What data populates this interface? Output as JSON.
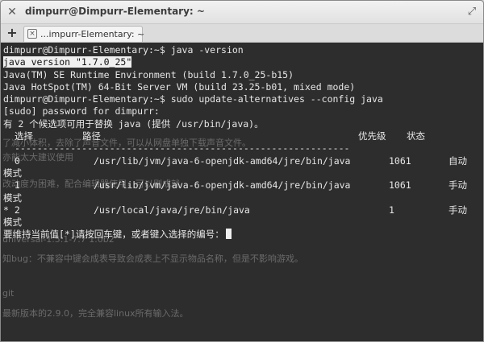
{
  "window": {
    "title": "dimpurr@Dimpurr-Elementary: ~",
    "close_glyph": "✕",
    "maximize_glyph": "⤢"
  },
  "tabs": {
    "new_tab_glyph": "+",
    "items": [
      {
        "label": "...impurr-Elementary: ~",
        "close_glyph": "×"
      }
    ]
  },
  "terminal": {
    "lines": [
      "dimpurr@Dimpurr-Elementary:~$ java -version",
      "java version \"1.7.0_25\"",
      "Java(TM) SE Runtime Environment (build 1.7.0_25-b15)",
      "Java HotSpot(TM) 64-Bit Server VM (build 23.25-b01, mixed mode)",
      "dimpurr@Dimpurr-Elementary:~$ sudo update-alternatives --config java",
      "[sudo] password for dimpurr:",
      "有 2 个候选项可用于替换 java (提供 /usr/bin/java)。"
    ],
    "table_header": {
      "select": "选择",
      "path": "路径",
      "priority": "优先级",
      "status": "状态"
    },
    "separator": "------------------------------------------------------------",
    "rows": [
      {
        "select": "  0",
        "path": "/usr/lib/jvm/java-6-openjdk-amd64/jre/bin/java",
        "priority": "1061",
        "status": "自动",
        "status_cont": "模式"
      },
      {
        "select": "  1",
        "path": "/usr/lib/jvm/java-6-openjdk-amd64/jre/bin/java",
        "priority": "1061",
        "status": "手动",
        "status_cont": "模式"
      },
      {
        "select": "* 2",
        "path": "/usr/local/java/jre/bin/java",
        "priority": "1",
        "status": "手动",
        "status_cont": "模式"
      }
    ],
    "prompt": "要维持当前值[*]请按回车键，或者键入选择的编号："
  },
  "background_text": {
    "lines": [
      {
        "text": "了减小体积，去除了声音文件，可以从网盘单独下载声音文件。"
      },
      {
        "text": "亦能太大建议使用"
      },
      {
        "text": "改动度为困难，配合编辑器使用，可以刷成就"
      },
      {
        "text": "universal-1.5.1-7.7 1.0b2"
      },
      {
        "text": "知bug：不兼容中键会成表导致会成表上不显示物品名称，但是不影响游戏。"
      },
      {
        "text": "git"
      },
      {
        "text": "最新版本的2.9.0，完全兼容linux所有输入法。"
      }
    ]
  },
  "colors": {
    "terminal_bg": "#2d2d2d",
    "terminal_fg": "#e6e6e6",
    "highlight_bg": "#efefef",
    "titlebar_bg": "#e8e8e8"
  }
}
